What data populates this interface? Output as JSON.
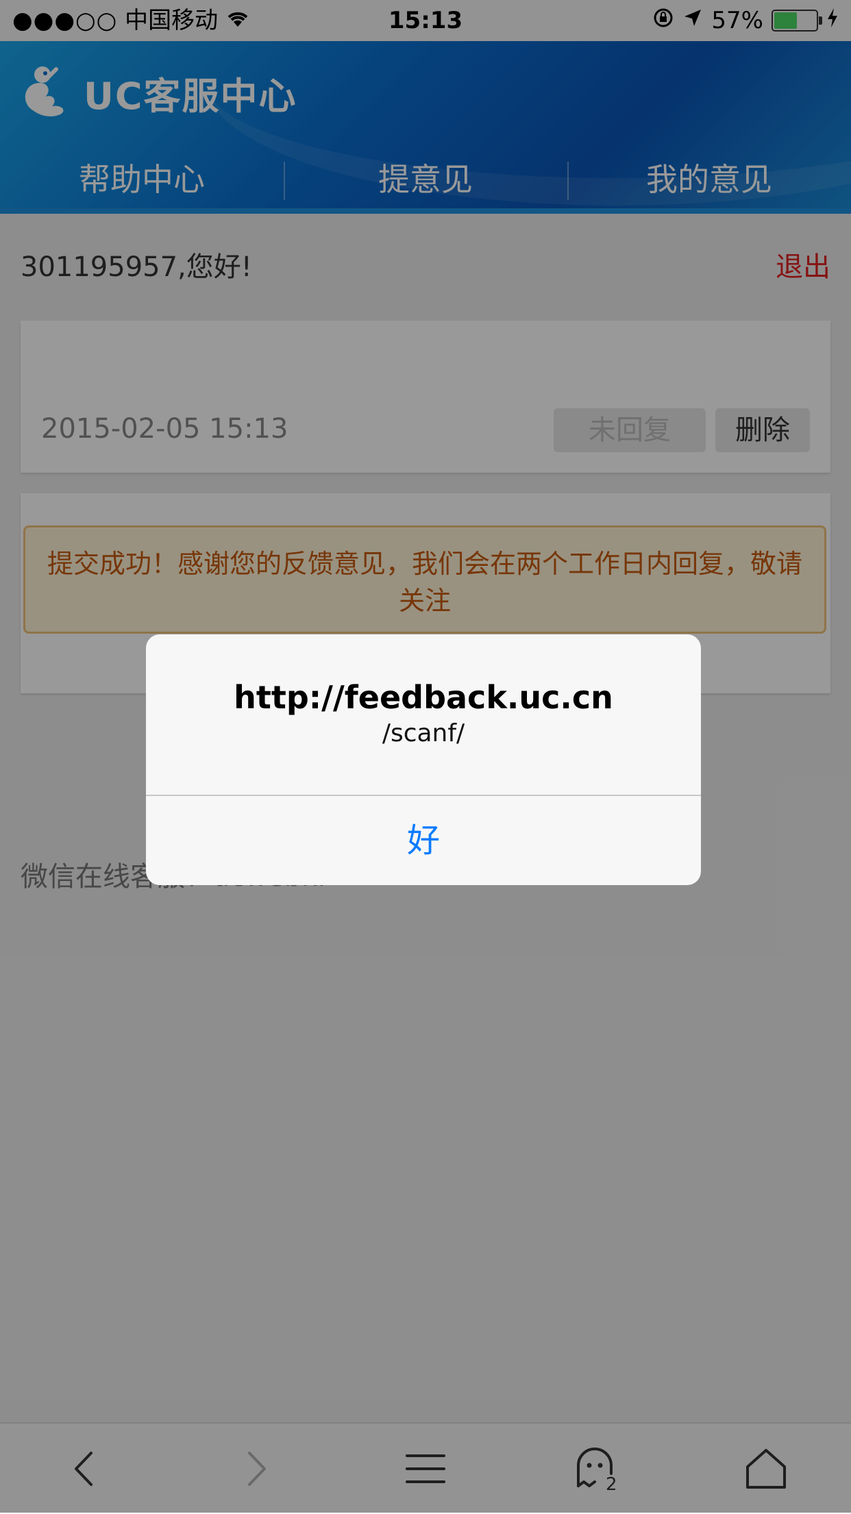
{
  "status_bar": {
    "signal": "●●●○○",
    "carrier": "中国移动",
    "time": "15:13",
    "battery": "57%",
    "battery_level": 0.57
  },
  "header": {
    "brand": "UC客服中心",
    "tabs": [
      {
        "label": "帮助中心"
      },
      {
        "label": "提意见"
      },
      {
        "label": "我的意见"
      }
    ]
  },
  "content": {
    "greeting": "301195957,您好!",
    "logout": "退出",
    "feedback_item": {
      "date": "2015-02-05 15:13",
      "status_button": "未回复",
      "delete_button": "删除"
    },
    "wechat_text": "微信在线客服：ucwebkf"
  },
  "toast": {
    "message": "提交成功！感谢您的反馈意见，我们会在两个工作日内回复，敬请关注"
  },
  "alert": {
    "title": "http://feedback.uc.cn",
    "message": "/scanf/",
    "ok_button": "好"
  },
  "toolbar": {
    "tab_count": "2"
  },
  "colors": {
    "accent_blue": "#0a7bff",
    "header_blue": "#0a6fd0",
    "logout_red": "#e02020",
    "toast_text": "#c65a10"
  }
}
